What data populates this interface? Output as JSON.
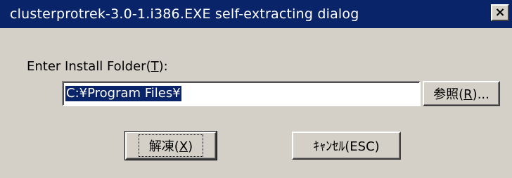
{
  "window": {
    "title": "clusterprotrek-3.0-1.i386.EXE self-extracting dialog",
    "close_glyph": "×",
    "close_icon": "close-icon"
  },
  "form": {
    "label_prefix": "Enter Install Folder(",
    "label_accel": "T",
    "label_suffix": "):",
    "install_path": "C:¥Program Files¥"
  },
  "buttons": {
    "browse_prefix": "参照(",
    "browse_accel": "R",
    "browse_suffix": ")...",
    "extract_prefix": "解凍(",
    "extract_accel": "X",
    "extract_suffix": ")",
    "cancel_label": "ｷｬﾝｾﾙ(ESC)"
  },
  "colors": {
    "titlebar": "#0a246a",
    "face": "#d4d0c8",
    "selection": "#0a246a"
  }
}
